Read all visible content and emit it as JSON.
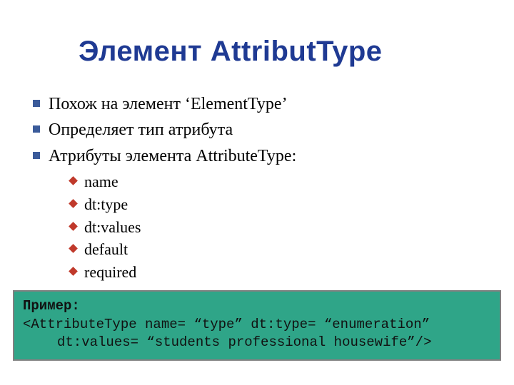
{
  "title": "Элемент AttributType",
  "bullets": [
    {
      "text": "Похож на элемент ‘ElementType’"
    },
    {
      "text": "Определяет тип атрибута"
    },
    {
      "text": "Атрибуты элемента AttributeType:"
    }
  ],
  "sub_bullets": [
    {
      "text": "name"
    },
    {
      "text": "dt:type"
    },
    {
      "text": "dt:values"
    },
    {
      "text": "default"
    },
    {
      "text": "required"
    }
  ],
  "example": {
    "label": "Пример:",
    "line1": "<AttributeType name= “type” dt:type= “enumeration”",
    "line2": "dt:values= “students professional housewife”/>"
  }
}
